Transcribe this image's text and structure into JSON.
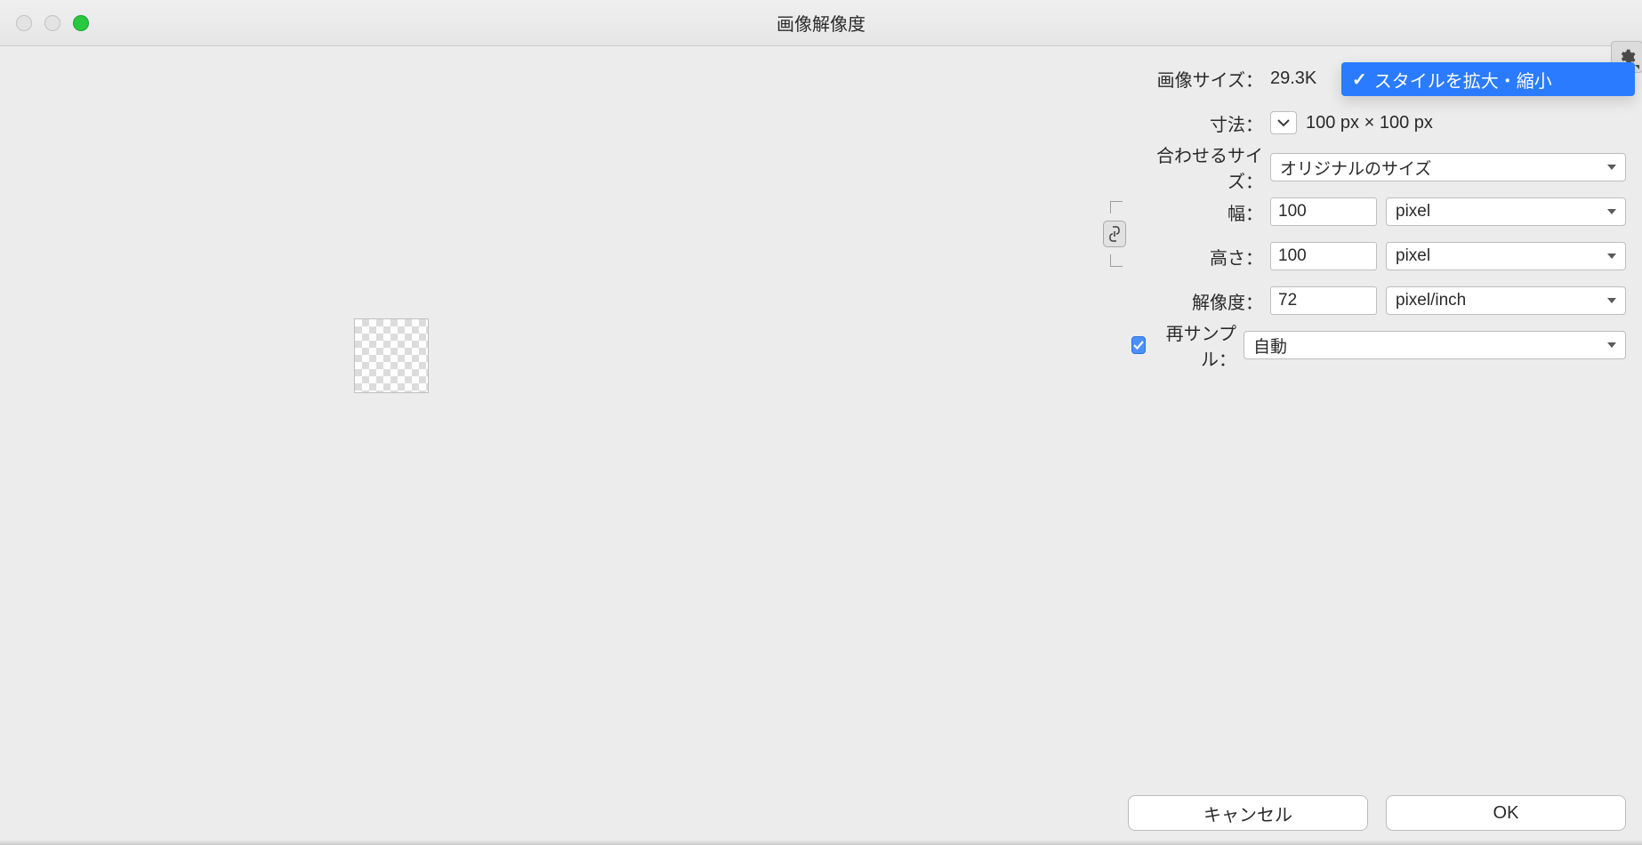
{
  "window": {
    "title": "画像解像度"
  },
  "image_size": {
    "label": "画像サイズ：",
    "value": "29.3K"
  },
  "dimensions": {
    "label": "寸法：",
    "value": "100 px × 100 px"
  },
  "fit_size": {
    "label": "合わせるサイズ：",
    "value": "オリジナルのサイズ"
  },
  "width": {
    "label": "幅：",
    "value": "100",
    "unit": "pixel"
  },
  "height": {
    "label": "高さ：",
    "value": "100",
    "unit": "pixel"
  },
  "resolution": {
    "label": "解像度：",
    "value": "72",
    "unit": "pixel/inch"
  },
  "resample": {
    "label": "再サンプル：",
    "value": "自動"
  },
  "popup": {
    "check": "✓",
    "label": "スタイルを拡大・縮小"
  },
  "buttons": {
    "cancel": "キャンセル",
    "ok": "OK"
  }
}
